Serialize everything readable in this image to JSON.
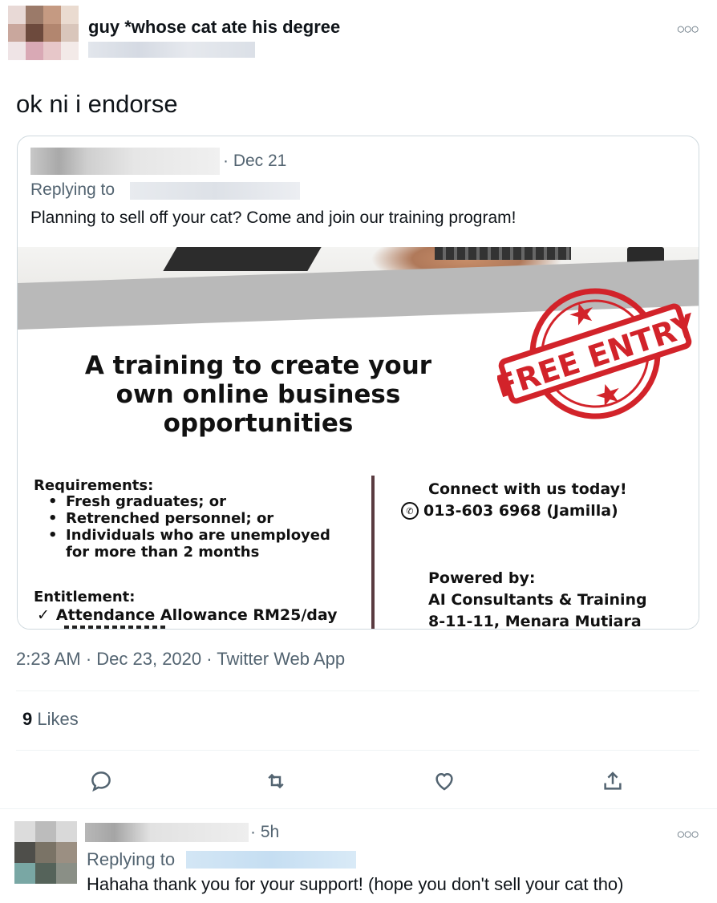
{
  "main_tweet": {
    "display_name": "guy *whose cat ate his degree",
    "text": "ok ni i endorse",
    "more_icon": "more-options-icon"
  },
  "quoted_tweet": {
    "date": "· Dec 21",
    "replying_to_label": "Replying to",
    "text": "Planning to sell off your cat? Come and join our training program!",
    "poster": {
      "stamp_text": "FREE ENTRY",
      "headline_lines": [
        "A training to create your",
        "own online business",
        "opportunities"
      ],
      "requirements_title": "Requirements:",
      "requirements": [
        "Fresh graduates; or",
        "Retrenched personnel; or",
        "Individuals who are unemployed",
        "for more than 2 months"
      ],
      "entitlement_title": "Entitlement:",
      "entitlement_item": "Attendance Allowance RM25/day",
      "connect_title": "Connect with us today!",
      "phone": "013-603 6968 (Jamilla)",
      "powered_by_title": "Powered by:",
      "company": "AI Consultants & Training",
      "address": "8-11-11, Menara Mutiara"
    }
  },
  "meta": {
    "timestamp": "2:23 AM · Dec 23, 2020 · Twitter Web App"
  },
  "likes": {
    "count": "9",
    "label": "Likes"
  },
  "actions": [
    "reply-icon",
    "retweet-icon",
    "like-icon",
    "share-icon"
  ],
  "reply": {
    "time": "· 5h",
    "replying_to_label": "Replying to",
    "text": "Hahaha thank you for your support! (hope you don't sell your cat tho)"
  },
  "colors": {
    "text_primary": "#0f1419",
    "text_secondary": "#536471",
    "border": "#cfd9de",
    "stamp_red": "#d2232a"
  }
}
